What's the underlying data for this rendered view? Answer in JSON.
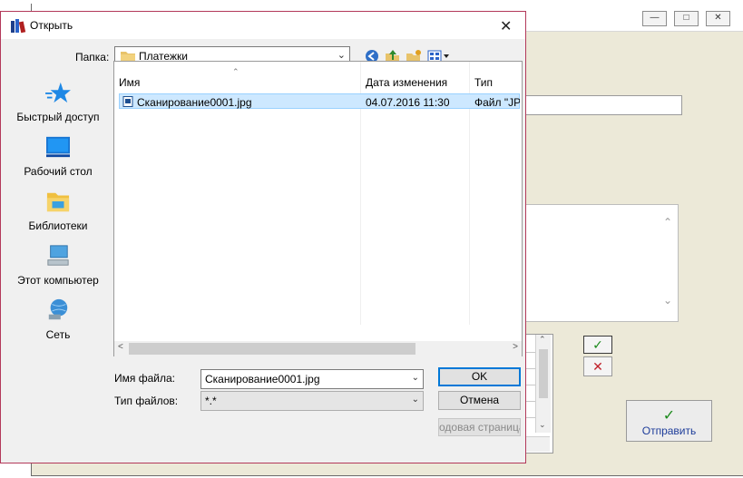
{
  "background_window": {
    "controls": {
      "minimize": "minimize-icon",
      "maximize": "maximize-icon",
      "close": "close-icon"
    },
    "send_label": "Отправить",
    "colors": {
      "confirm": "#1b8a1b",
      "cancel": "#c0202a",
      "link": "#1d3c9a"
    }
  },
  "dialog": {
    "title": "Открыть",
    "folder_label": "Папка:",
    "folder_value": "Платежки",
    "toolbar": {
      "back": "back-icon",
      "up": "up-folder-icon",
      "new_folder": "new-folder-icon",
      "view": "view-menu-icon"
    },
    "places": [
      {
        "label": "Быстрый доступ",
        "icon": "star-icon"
      },
      {
        "label": "Рабочий стол",
        "icon": "desktop-icon"
      },
      {
        "label": "Библиотеки",
        "icon": "libraries-icon"
      },
      {
        "label": "Этот компьютер",
        "icon": "computer-icon"
      },
      {
        "label": "Сеть",
        "icon": "network-icon"
      }
    ],
    "columns": {
      "name": "Имя",
      "date": "Дата изменения",
      "type": "Тип"
    },
    "files": [
      {
        "name": "Сканирование0001.jpg",
        "date": "04.07.2016 11:30",
        "type": "Файл \"JPG\""
      }
    ],
    "filename_label": "Имя файла:",
    "filename_value": "Сканирование0001.jpg",
    "filetype_label": "Тип файлов:",
    "filetype_value": "*.*",
    "open_label": "OK",
    "cancel_label": "Отмена",
    "web_label": "одовая страница"
  }
}
